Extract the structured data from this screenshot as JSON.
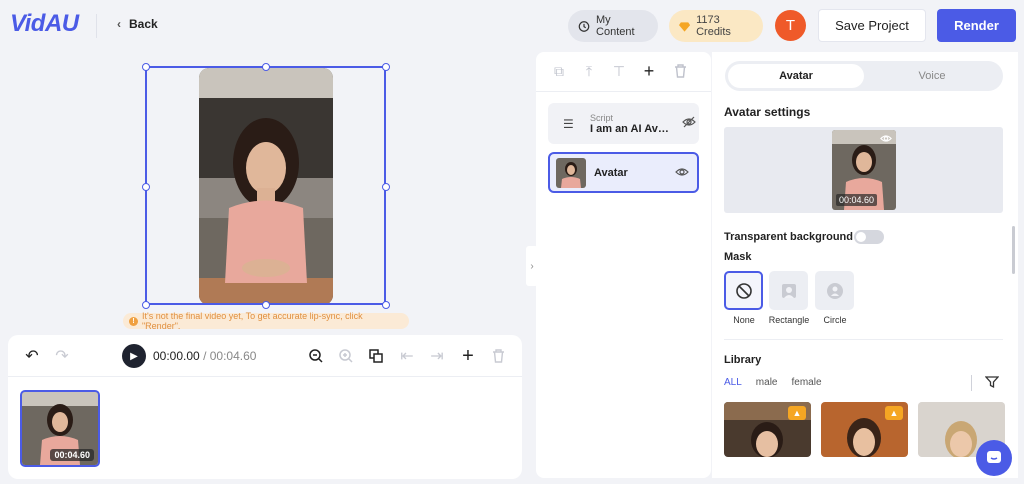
{
  "header": {
    "logo": "VidAU",
    "back_label": "Back",
    "my_content_label": "My Content",
    "credits_label": "1173 Credits",
    "user_initial": "T",
    "save_label": "Save Project",
    "render_label": "Render"
  },
  "canvas": {
    "warning": "It's not the final video yet, To get accurate lip-sync, click \"Render\"."
  },
  "timeline": {
    "current_time": "00:00.00",
    "separator": "/",
    "duration": "00:04.60",
    "clip_duration": "00:04.60"
  },
  "layers": {
    "items": [
      {
        "subtitle": "Script",
        "title": "I am an AI Avatar"
      },
      {
        "title": "Avatar"
      }
    ]
  },
  "settings": {
    "tabs": [
      "Avatar",
      "Voice"
    ],
    "section_title": "Avatar settings",
    "preview_duration": "00:04.60",
    "transparent_bg_label": "Transparent background",
    "transparent_bg_on": false,
    "mask_label": "Mask",
    "mask_options": [
      "None",
      "Rectangle",
      "Circle"
    ],
    "selected_mask": "None",
    "library_label": "Library",
    "library_filters": [
      "ALL",
      "male",
      "female"
    ],
    "active_filter": "ALL"
  },
  "colors": {
    "brand": "#4b5be6",
    "user_avatar": "#ef5a29",
    "credits_bg": "#fbe8c4"
  }
}
